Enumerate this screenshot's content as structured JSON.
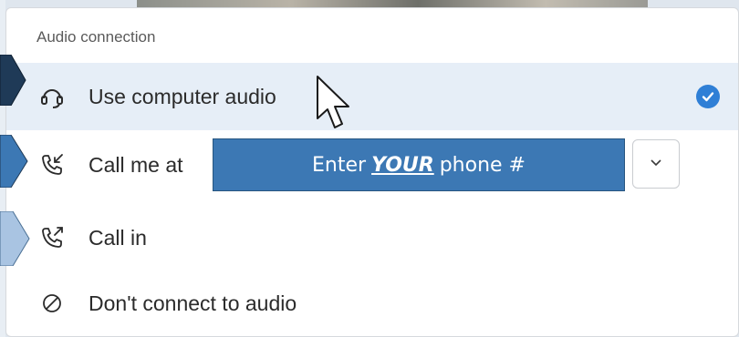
{
  "panel": {
    "title": "Audio connection"
  },
  "options": [
    {
      "label": "Use computer audio",
      "icon": "headset-icon",
      "selected": true
    },
    {
      "label": "Call me at",
      "icon": "phone-incoming-icon",
      "selected": false
    },
    {
      "label": "Call in",
      "icon": "phone-outgoing-icon",
      "selected": false
    },
    {
      "label": "Don't connect to audio",
      "icon": "no-audio-icon",
      "selected": false
    }
  ],
  "phone_input": {
    "prefix": "Enter",
    "emphasis": "YOUR",
    "suffix": "phone #"
  },
  "colors": {
    "accent": "#2f7fd6",
    "selected_row": "#e6eef7",
    "callout_fill": "#3c78b4",
    "step1_arrow": "#1f3a57",
    "step2_arrow": "#3c78b4",
    "step3_arrow": "#a9c4e2"
  }
}
